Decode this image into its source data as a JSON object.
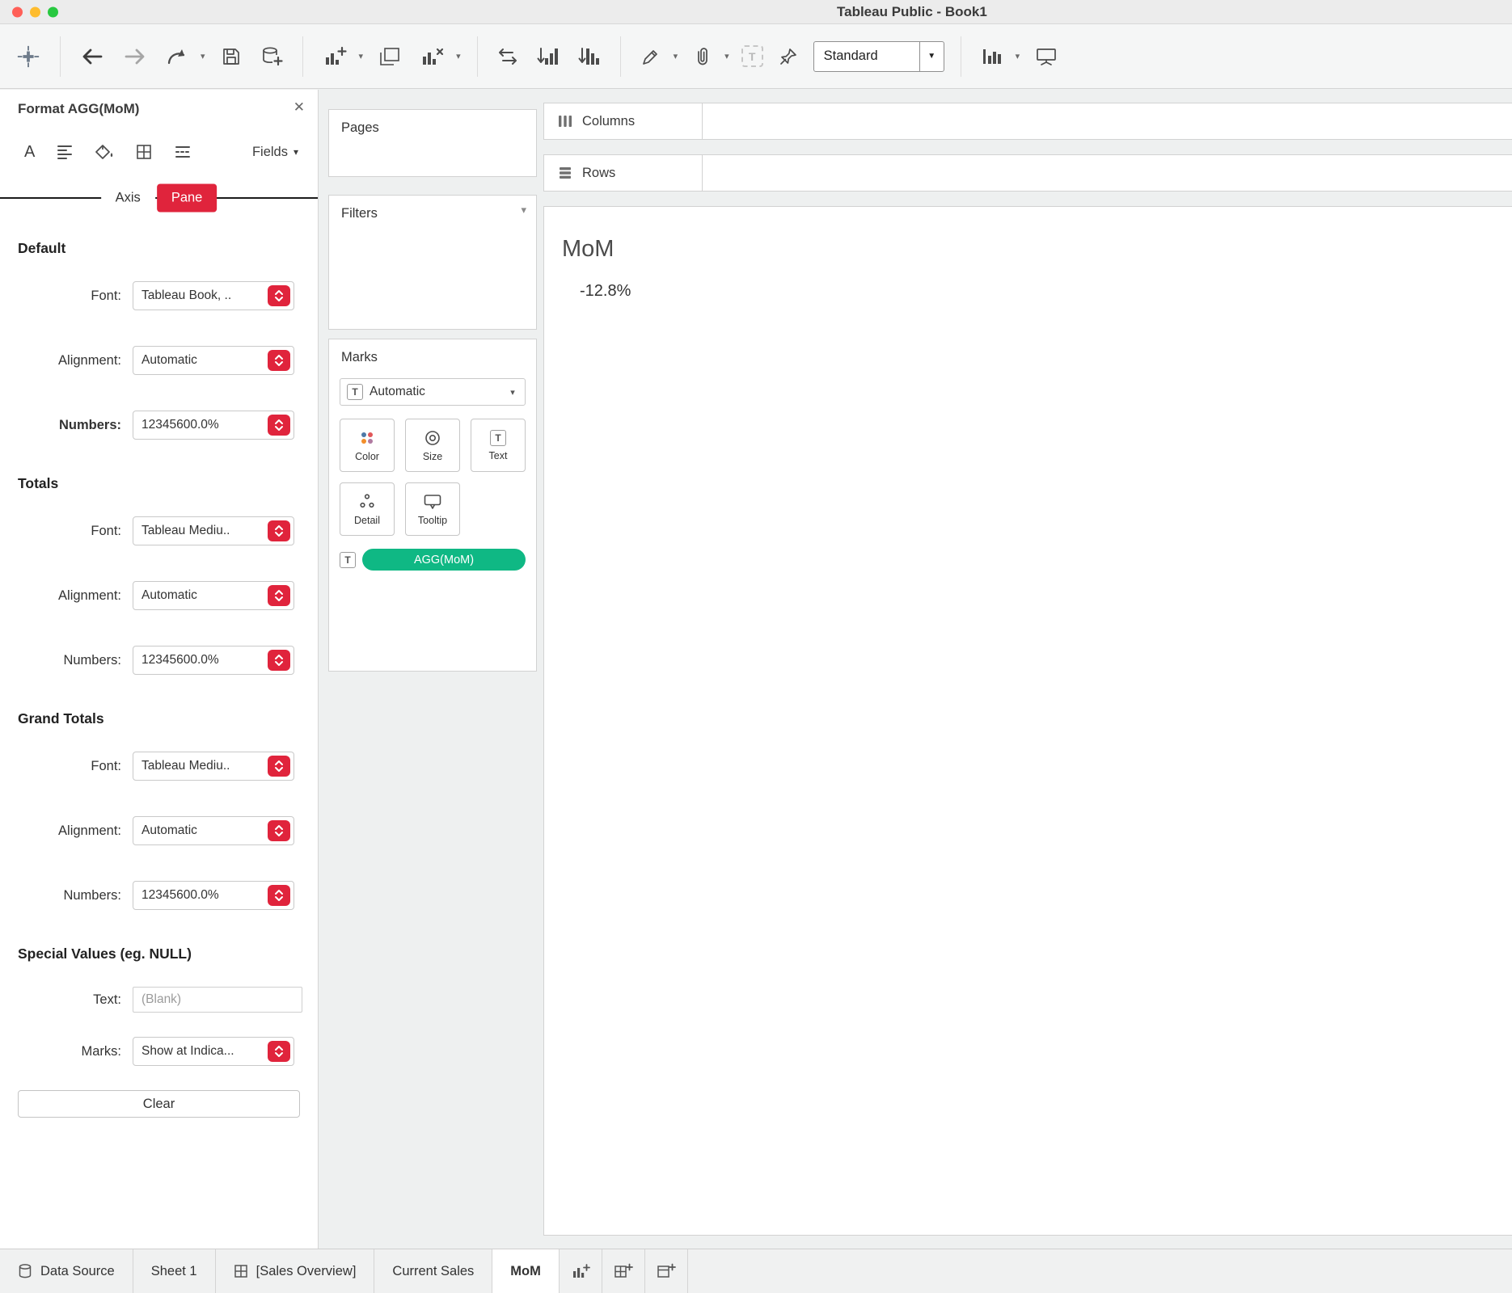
{
  "window": {
    "title": "Tableau Public - Book1"
  },
  "toolbar": {
    "view_mode": "Standard"
  },
  "icons": {
    "close": "✕",
    "caret_down": "▾",
    "caret_solid": "▼",
    "text_mark": "T",
    "font_a": "A"
  },
  "colors": {
    "accent_red": "#e0243c",
    "pill_green": "#0fb884"
  },
  "format_panel": {
    "title": "Format AGG(MoM)",
    "fields_button": "Fields",
    "tabs": {
      "axis": "Axis",
      "pane": "Pane"
    },
    "default": {
      "heading": "Default",
      "font_label": "Font:",
      "font_value": "Tableau Book, ..",
      "alignment_label": "Alignment:",
      "alignment_value": "Automatic",
      "numbers_label": "Numbers:",
      "numbers_value": "12345600.0%"
    },
    "totals": {
      "heading": "Totals",
      "font_label": "Font:",
      "font_value": "Tableau Mediu..",
      "alignment_label": "Alignment:",
      "alignment_value": "Automatic",
      "numbers_label": "Numbers:",
      "numbers_value": "12345600.0%"
    },
    "grand_totals": {
      "heading": "Grand Totals",
      "font_label": "Font:",
      "font_value": "Tableau Mediu..",
      "alignment_label": "Alignment:",
      "alignment_value": "Automatic",
      "numbers_label": "Numbers:",
      "numbers_value": "12345600.0%"
    },
    "special_values": {
      "heading": "Special Values (eg. NULL)",
      "text_label": "Text:",
      "text_placeholder": "(Blank)",
      "marks_label": "Marks:",
      "marks_value": "Show at Indica..."
    },
    "clear_button": "Clear"
  },
  "cards": {
    "pages": {
      "title": "Pages"
    },
    "filters": {
      "title": "Filters"
    },
    "marks": {
      "title": "Marks",
      "type_selector": "Automatic",
      "buttons": {
        "color": "Color",
        "size": "Size",
        "text": "Text",
        "detail": "Detail",
        "tooltip": "Tooltip"
      },
      "pill": "AGG(MoM)"
    }
  },
  "shelves": {
    "columns": "Columns",
    "rows": "Rows"
  },
  "worksheet": {
    "title": "MoM",
    "value": "-12.8%"
  },
  "sheet_tabs": {
    "data_source": "Data Source",
    "sheet1": "Sheet 1",
    "sales_overview": "[Sales Overview]",
    "current_sales": "Current Sales",
    "mom": "MoM"
  }
}
